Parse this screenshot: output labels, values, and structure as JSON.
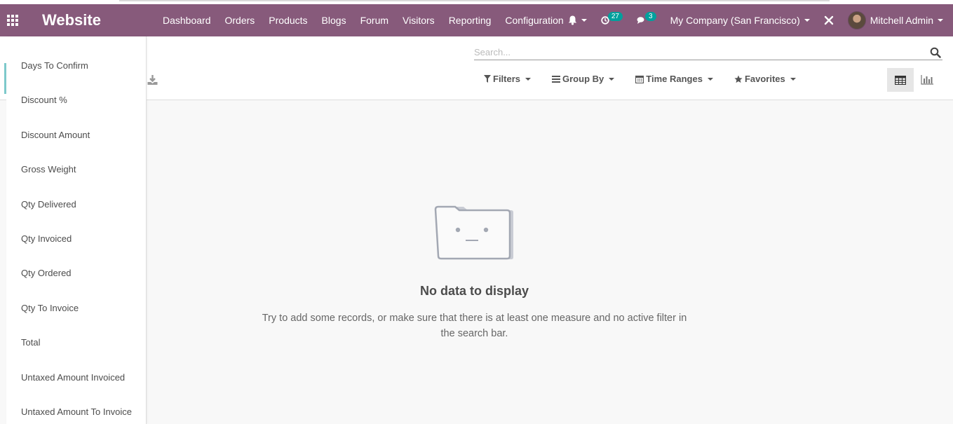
{
  "navbar": {
    "brand": "Website",
    "menu": [
      "Dashboard",
      "Orders",
      "Products",
      "Blogs",
      "Forum",
      "Visitors",
      "Reporting",
      "Configuration"
    ],
    "activity_count": "27",
    "messages_count": "3",
    "company": "My Company (San Francisco)",
    "user": "Mitchell Admin"
  },
  "search": {
    "placeholder": "Search..."
  },
  "filters": {
    "filters_label": "Filters",
    "groupby_label": "Group By",
    "timeranges_label": "Time Ranges",
    "favorites_label": "Favorites"
  },
  "measures_dropdown": {
    "items": [
      "Days To Confirm",
      "Discount %",
      "Discount Amount",
      "Gross Weight",
      "Qty Delivered",
      "Qty Invoiced",
      "Qty Ordered",
      "Qty To Invoice",
      "Total",
      "Untaxed Amount Invoiced",
      "Untaxed Amount To Invoice"
    ]
  },
  "empty_state": {
    "title": "No data to display",
    "text": "Try to add some records, or make sure that there is at least one measure and no active filter in the search bar."
  },
  "colors": {
    "navbar": "#875a7b",
    "badge": "#00a09d"
  }
}
